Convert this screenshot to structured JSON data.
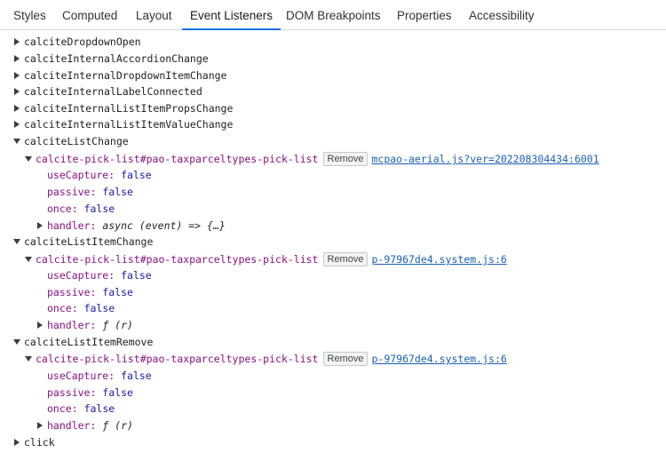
{
  "tabs": [
    {
      "label": "Styles"
    },
    {
      "label": "Computed"
    },
    {
      "label": "Layout"
    },
    {
      "label": "Event Listeners",
      "active": true
    },
    {
      "label": "DOM Breakpoints"
    },
    {
      "label": "Properties"
    },
    {
      "label": "Accessibility"
    }
  ],
  "events_collapsed_top": [
    "calciteDropdownOpen",
    "calciteInternalAccordionChange",
    "calciteInternalDropdownItemChange",
    "calciteInternalLabelConnected",
    "calciteInternalListItemPropsChange",
    "calciteInternalListItemValueChange"
  ],
  "expanded_events": [
    {
      "name": "calciteListChange",
      "listener": {
        "node": "calcite-pick-list#pao-taxparceltypes-pick-list",
        "remove_label": "Remove",
        "source": "mcpao-aerial.js?ver=202208304434:6001",
        "useCapture": "false",
        "passive": "false",
        "once": "false",
        "handler": "async (event) => {…}"
      }
    },
    {
      "name": "calciteListItemChange",
      "listener": {
        "node": "calcite-pick-list#pao-taxparceltypes-pick-list",
        "remove_label": "Remove",
        "source": "p-97967de4.system.js:6",
        "useCapture": "false",
        "passive": "false",
        "once": "false",
        "handler": "ƒ (r)"
      }
    },
    {
      "name": "calciteListItemRemove",
      "listener": {
        "node": "calcite-pick-list#pao-taxparceltypes-pick-list",
        "remove_label": "Remove",
        "source": "p-97967de4.system.js:6",
        "useCapture": "false",
        "passive": "false",
        "once": "false",
        "handler": "ƒ (r)"
      }
    }
  ],
  "events_collapsed_bottom": [
    "click"
  ],
  "property_labels": {
    "useCapture": "useCapture:",
    "passive": "passive:",
    "once": "once:",
    "handler": "handler:"
  },
  "icons": {
    "collapsed": "triangle-right-icon",
    "expanded": "triangle-down-icon"
  },
  "colors": {
    "accent": "#1a73e8",
    "node": "#881280",
    "boolean": "#1a1aa6",
    "link": "#1a5fb4"
  }
}
